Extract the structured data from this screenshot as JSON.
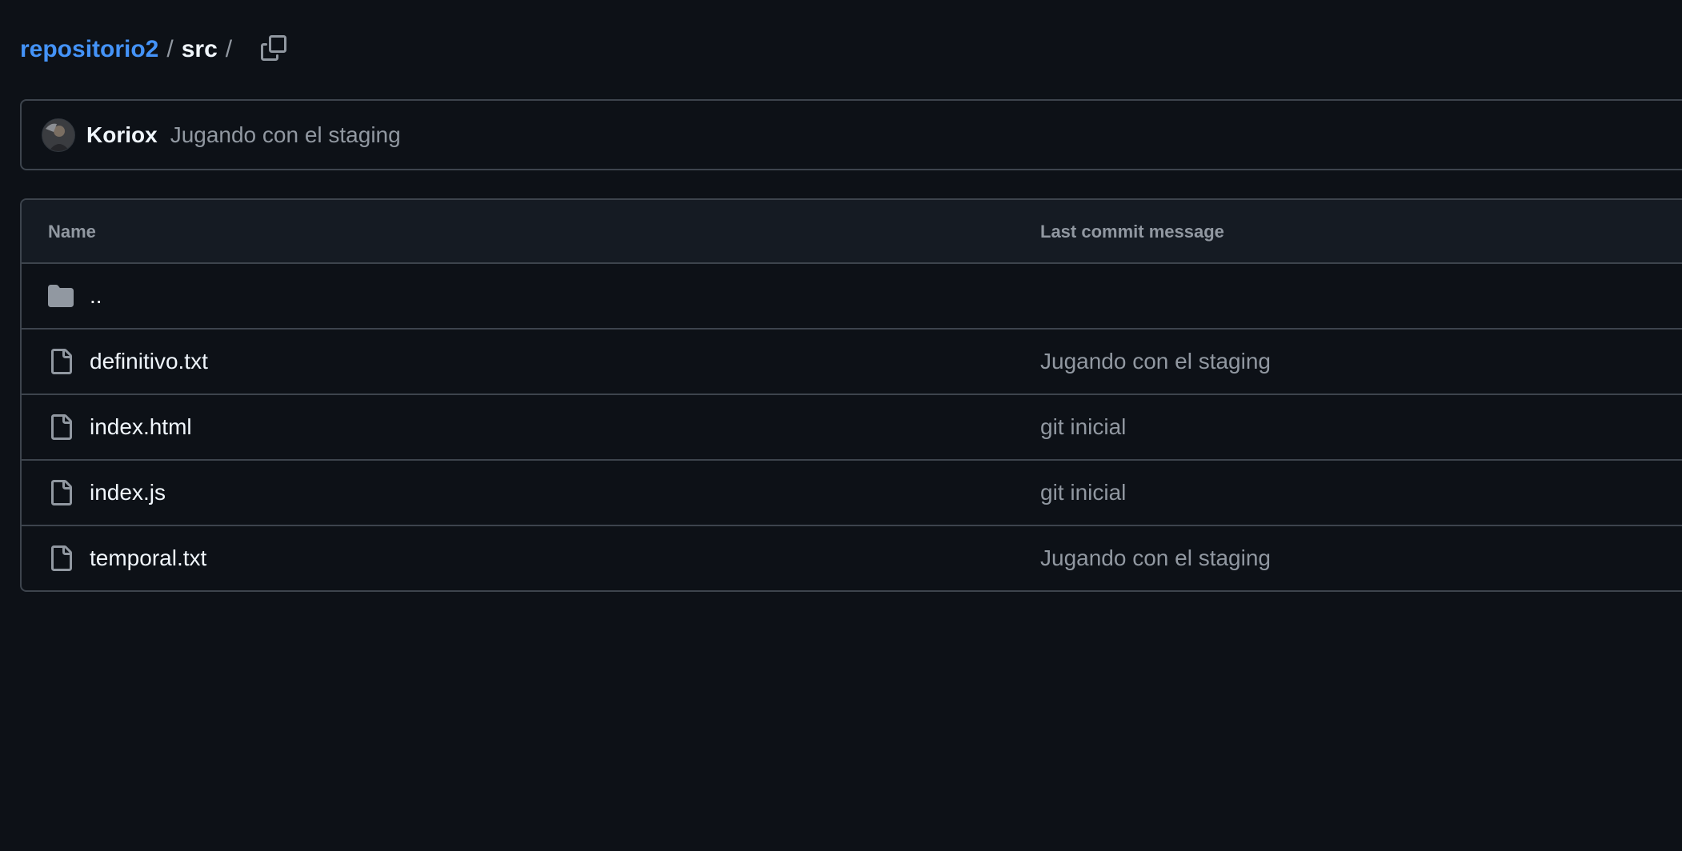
{
  "breadcrumb": {
    "repo": "repositorio2",
    "separator": "/",
    "current": "src",
    "trailing": "/",
    "copy_icon": "copy-icon"
  },
  "latest_commit": {
    "author": "Koriox",
    "message": "Jugando con el staging",
    "avatar_icon": "avatar"
  },
  "table": {
    "headers": {
      "name": "Name",
      "last_commit": "Last commit message"
    },
    "rows": [
      {
        "icon": "folder-icon",
        "name": "..",
        "commit": ""
      },
      {
        "icon": "file-icon",
        "name": "definitivo.txt",
        "commit": "Jugando con el staging"
      },
      {
        "icon": "file-icon",
        "name": "index.html",
        "commit": "git inicial"
      },
      {
        "icon": "file-icon",
        "name": "index.js",
        "commit": "git inicial"
      },
      {
        "icon": "file-icon",
        "name": "temporal.txt",
        "commit": "Jugando con el staging"
      }
    ]
  },
  "colors": {
    "background": "#0d1117",
    "link": "#4493f8",
    "text_primary": "#f0f6fc",
    "text_muted": "#9198a1",
    "border": "#3d444d",
    "header_bg": "#151b23"
  }
}
